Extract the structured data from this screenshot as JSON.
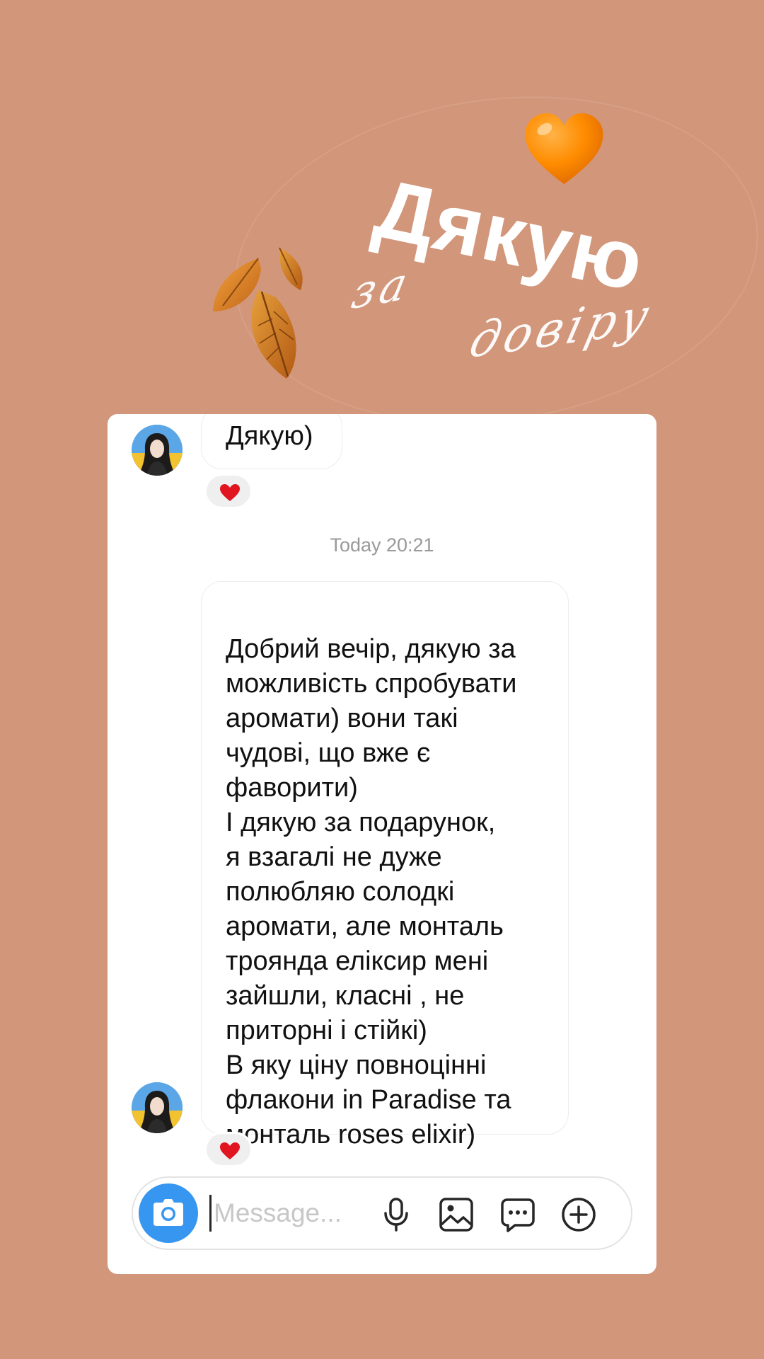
{
  "story": {
    "title": "Дякую",
    "script_line_1": "за",
    "script_line_2": "довіру",
    "background_color": "#D2967A",
    "stickers": [
      "orange-heart-icon",
      "autumn-leaves-icon"
    ]
  },
  "chat": {
    "messages": [
      {
        "sender": "other",
        "text": "Дякую)",
        "reaction": "heart-icon"
      },
      {
        "sender": "other",
        "text": "Добрий вечір, дякую за\nможливість спробувати\nаромати) вони такі\nчудові, що вже є\nфаворити)\nІ дякую за подарунок,\nя взагалі не дуже\nполюбляю солодкі\nаромати, але монталь\nтроянда еліксир мені\nзайшли, класні , не\nприторні і стійкі)\nВ яку ціну повноцінні\nфлакони in Paradise та\nмонталь roses elixir)",
        "reaction": "heart-icon"
      }
    ],
    "timestamp": "Today 20:21",
    "reaction_color": "#E0151F"
  },
  "composer": {
    "placeholder": "Message...",
    "value": "",
    "accent_color": "#3797F0",
    "icons": [
      "camera-icon",
      "microphone-icon",
      "gallery-icon",
      "sticker-icon",
      "plus-icon"
    ]
  }
}
